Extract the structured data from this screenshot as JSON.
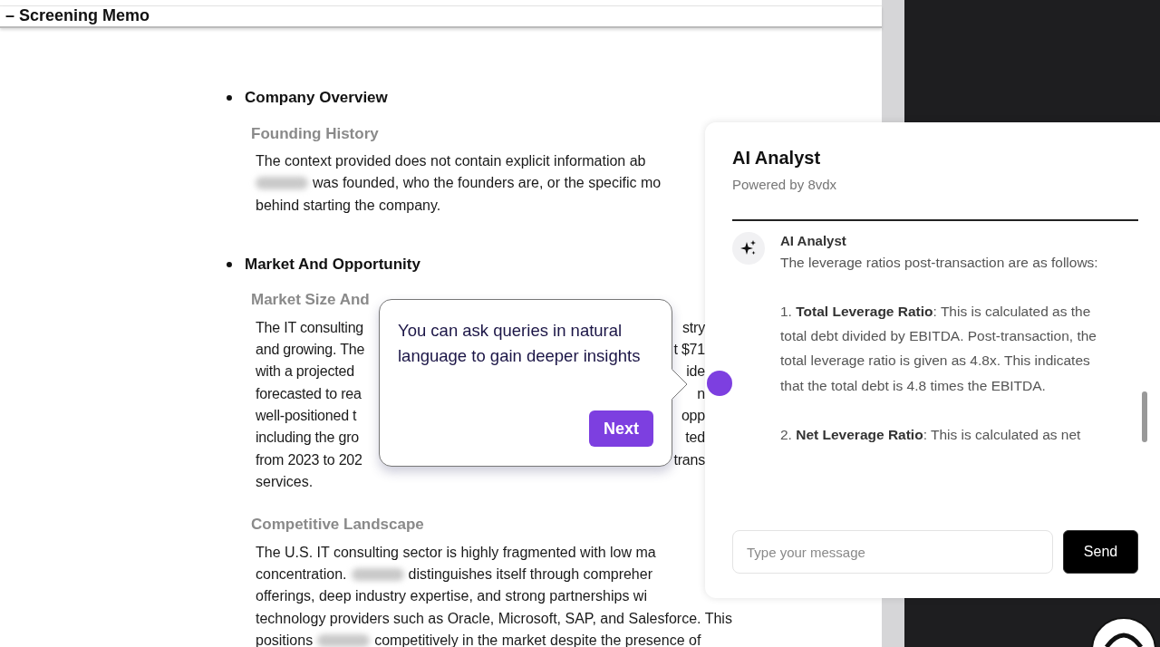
{
  "header": {
    "title": "– Screening Memo"
  },
  "document": {
    "sections": [
      {
        "heading": "Company Overview",
        "subsections": [
          {
            "heading": "Founding History",
            "lines": [
              [
                {
                  "kind": "text",
                  "text": "The context provided does not contain explicit information ab"
                }
              ],
              [
                {
                  "kind": "redacted"
                },
                {
                  "kind": "text",
                  "text": "was founded, who the founders are, or the specific mo"
                }
              ],
              [
                {
                  "kind": "text",
                  "text": "behind starting the company."
                }
              ]
            ]
          }
        ]
      },
      {
        "heading": "Market And Opportunity",
        "subsections": [
          {
            "heading": "Market Size And",
            "lines": [
              [
                {
                  "kind": "text",
                  "text": "The IT consulting"
                },
                {
                  "kind": "covered"
                },
                {
                  "kind": "text",
                  "text": "stry"
                }
              ],
              [
                {
                  "kind": "text",
                  "text": "and growing. The"
                },
                {
                  "kind": "covered"
                },
                {
                  "kind": "text",
                  "text": "t $71"
                }
              ],
              [
                {
                  "kind": "text",
                  "text": "with a projected"
                },
                {
                  "kind": "covered"
                },
                {
                  "kind": "text",
                  "text": "ide"
                }
              ],
              [
                {
                  "kind": "text",
                  "text": "forecasted to rea"
                },
                {
                  "kind": "covered"
                },
                {
                  "kind": "text",
                  "text": "n"
                }
              ],
              [
                {
                  "kind": "text",
                  "text": "well-positioned t"
                },
                {
                  "kind": "covered"
                },
                {
                  "kind": "text",
                  "text": "opp"
                }
              ],
              [
                {
                  "kind": "text",
                  "text": "including the gro"
                },
                {
                  "kind": "covered"
                },
                {
                  "kind": "text",
                  "text": "ted"
                }
              ],
              [
                {
                  "kind": "text",
                  "text": "from 2023 to 202"
                },
                {
                  "kind": "covered"
                },
                {
                  "kind": "text",
                  "text": "trans"
                }
              ],
              [
                {
                  "kind": "text",
                  "text": "services."
                }
              ]
            ]
          },
          {
            "heading": "Competitive Landscape",
            "lines": [
              [
                {
                  "kind": "text",
                  "text": "The U.S. IT consulting sector is highly fragmented with low ma"
                }
              ],
              [
                {
                  "kind": "text",
                  "text": "concentration."
                },
                {
                  "kind": "redacted"
                },
                {
                  "kind": "text",
                  "text": "distinguishes itself through compreher"
                }
              ],
              [
                {
                  "kind": "text",
                  "text": "offerings, deep industry expertise, and strong partnerships wi"
                }
              ],
              [
                {
                  "kind": "text",
                  "text": "technology providers such as Oracle, Microsoft, SAP, and Salesforce. This"
                }
              ],
              [
                {
                  "kind": "text",
                  "text": "positions"
                },
                {
                  "kind": "redacted"
                },
                {
                  "kind": "text",
                  "text": "competitively in the market despite the presence of"
                }
              ]
            ]
          }
        ]
      }
    ]
  },
  "tour_tooltip": {
    "text": "You can ask queries in natural language to gain deeper insights",
    "button": "Next"
  },
  "chat_panel": {
    "title": "AI Analyst",
    "subtitle": "Powered by 8vdx",
    "messages": [
      {
        "sender": "AI Analyst",
        "paragraphs": [
          "The leverage ratios post-transaction are as follows:",
          "1. **Total Leverage Ratio**: This is calculated as the total debt divided by EBITDA. Post-transaction, the total leverage ratio is given as 4.8x. This indicates that the total debt is 4.8 times the EBITDA.",
          "2. **Net Leverage Ratio**: This is calculated as net"
        ]
      }
    ],
    "input": {
      "placeholder": "Type your message"
    },
    "send_button": "Send"
  }
}
